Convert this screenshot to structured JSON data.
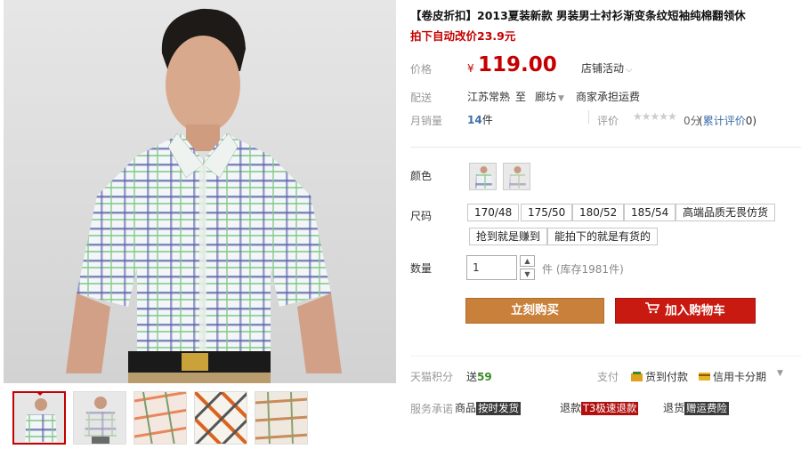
{
  "product": {
    "title": "【卷皮折扣】2013夏装新款 男装男士衬衫渐变条纹短袖纯棉翻领休",
    "subtitle": "拍下自动改价23.9元"
  },
  "price": {
    "label": "价格",
    "currency": "¥",
    "value": "119.00",
    "promo": "店铺活动",
    "promo_chevron": "⌵"
  },
  "shipping": {
    "label": "配送",
    "from": "江苏常熟",
    "to_word": "至",
    "to": "廊坊",
    "to_arrow": "▼",
    "fee": "商家承担运费"
  },
  "sales": {
    "label": "月销量",
    "count": "14",
    "unit": "件",
    "rating_label": "评价",
    "stars": "★★★★★",
    "score": "0分",
    "count_text_open": "(",
    "count_text_link": "累计评价",
    "count_text_num": "0",
    "count_text_close": ")"
  },
  "color": {
    "label": "颜色"
  },
  "size": {
    "label": "尺码",
    "options": [
      "170/48",
      "175/50",
      "180/52",
      "185/54",
      "高端品质无畏仿货",
      "抢到就是赚到",
      "能拍下的就是有货的"
    ]
  },
  "quantity": {
    "label": "数量",
    "value": "1",
    "unit": "件",
    "stock": "(库存1981件)"
  },
  "actions": {
    "buy_now": "立刻购买",
    "add_cart": "加入购物车"
  },
  "points": {
    "label": "天猫积分",
    "send": "送",
    "value": "59"
  },
  "payment": {
    "title": "支付",
    "cod": "货到付款",
    "installment": "信用卡分期",
    "more": "▼"
  },
  "service": {
    "label": "服务承诺",
    "item1_prefix": "商品",
    "item1_tag": "按时发货",
    "item2_prefix": "退款",
    "item2_tag": "T3极速退款",
    "item3_prefix": "退货",
    "item3_tag": "赠运费险"
  },
  "colors": {
    "price_red": "#c40000",
    "buy_orange": "#c8803a",
    "cart_red": "#c81a11",
    "link_blue": "#3c6ea9",
    "points_green": "#3b8a2a"
  }
}
